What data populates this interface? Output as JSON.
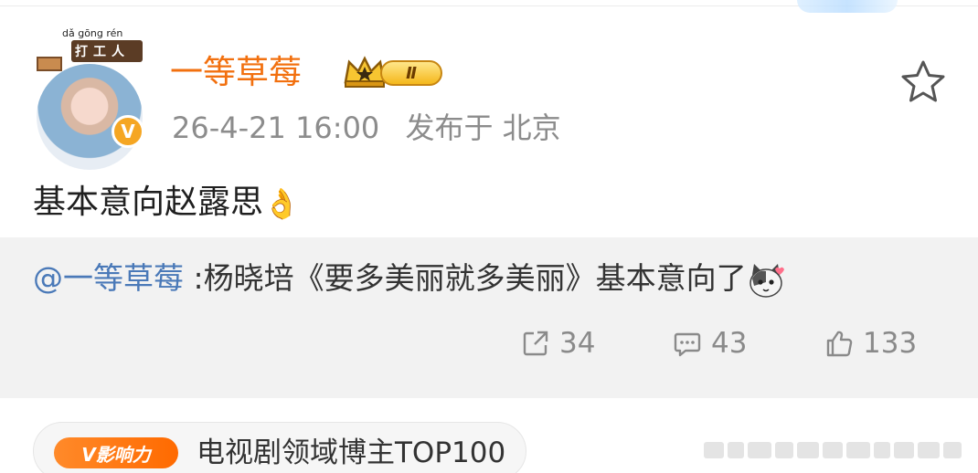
{
  "post": {
    "author": {
      "name": "一等草莓",
      "avatar_frame_pinyin": "dǎ gōng rén",
      "avatar_frame_text": "打工人",
      "verified_badge": "V",
      "vip_level": "Ⅱ"
    },
    "meta": {
      "timestamp": "26-4-21 16:00",
      "location": "发布于 北京"
    },
    "text": "基本意向赵露思",
    "text_emoji": "👌",
    "favorite_icon": "star-outline-icon"
  },
  "quoted": {
    "mention": "@一等草莓",
    "text": " :杨晓培《要多美丽就多美丽》基本意向了",
    "emoji": "cat-face-icon",
    "actions": {
      "repost_count": "34",
      "comment_count": "43",
      "like_count": "133"
    }
  },
  "influence": {
    "badge": "V影响力",
    "label": "电视剧领域博主TOP100"
  },
  "colors": {
    "username": "#f2700f",
    "mention": "#4a79b8",
    "meta": "#8c8c8c",
    "quote_bg": "#f2f2f2",
    "badge_orange": "#ff6a00"
  }
}
